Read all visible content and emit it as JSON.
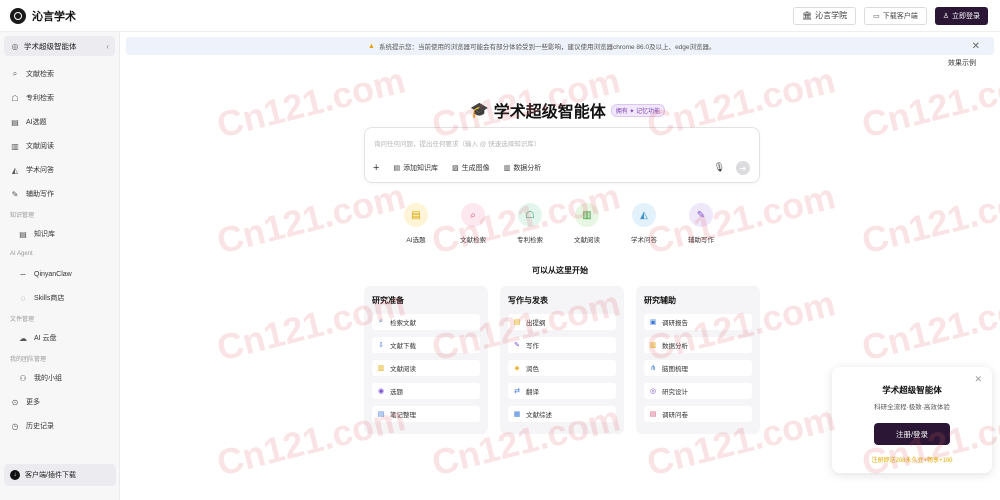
{
  "app": {
    "name": "沁言学术"
  },
  "topbar": {
    "academy_label": "沁言学院",
    "download_label": "下载客户端",
    "login_label": "立即登录"
  },
  "sidebar": {
    "head_label": "学术超级智能体",
    "items": [
      {
        "label": "文献检索",
        "icon": "document-search-icon"
      },
      {
        "label": "专利检索",
        "icon": "patent-icon"
      },
      {
        "label": "AI选题",
        "icon": "ai-topic-icon"
      },
      {
        "label": "文献阅读",
        "icon": "book-icon"
      },
      {
        "label": "学术问答",
        "icon": "graduation-cap-icon"
      },
      {
        "label": "辅助写作",
        "icon": "pen-icon"
      }
    ],
    "section_knowledge": "知识管理",
    "knowledge_item": "知识库",
    "section_agent": "AI Agent",
    "agent_items": [
      "QinyanClaw",
      "Skills商店"
    ],
    "section_files": "文件管理",
    "files_item": "AI 云盘",
    "section_team": "我的团队管理",
    "team_item": "我的小组",
    "more_label": "更多",
    "history_label": "历史记录",
    "bottom_label": "客户端/插件下载"
  },
  "notice": {
    "text": "系统提示您：当前使用的浏览器可能会有部分体验受到一些影响，建议使用浏览器chrome 86.0及以上、edge浏览器。",
    "example_label": "效果示例"
  },
  "hero": {
    "title": "学术超级智能体",
    "badge": "拥有 ✦ 记忆功能"
  },
  "input": {
    "placeholder": "询问任何问题，提出任何要求（输入 @ 快速选择知识库）",
    "add_kb": "添加知识库",
    "gen_image": "生成图像",
    "data_analysis": "数据分析"
  },
  "features": [
    {
      "label": "AI选题",
      "icon": "ai-topic-icon",
      "color": "#fff5d6",
      "fg": "#d9a400",
      "glyph": "▤"
    },
    {
      "label": "文献检索",
      "icon": "document-search-icon",
      "color": "#fde8ef",
      "fg": "#d8587c",
      "glyph": "⌕"
    },
    {
      "label": "专利检索",
      "icon": "patent-icon",
      "color": "#e2f6ee",
      "fg": "#2d9c70",
      "glyph": "☖"
    },
    {
      "label": "文献阅读",
      "icon": "book-icon",
      "color": "#e8f6e4",
      "fg": "#3d9a3a",
      "glyph": "▥"
    },
    {
      "label": "学术问答",
      "icon": "graduation-cap-icon",
      "color": "#e3f1fb",
      "fg": "#3b8fcf",
      "glyph": "◭"
    },
    {
      "label": "辅助写作",
      "icon": "pen-icon",
      "color": "#efe8fb",
      "fg": "#7b4fcf",
      "glyph": "✎"
    }
  ],
  "start_title": "可以从这里开始",
  "cards": [
    {
      "title": "研究准备",
      "items": [
        {
          "label": "检索文献",
          "icon": "search-icon",
          "glyph": "⌕",
          "fg": "#3b7bd8"
        },
        {
          "label": "文献下载",
          "icon": "download-icon",
          "glyph": "⇩",
          "fg": "#3b7bd8"
        },
        {
          "label": "文献阅读",
          "icon": "book-icon",
          "glyph": "▥",
          "fg": "#e0a800"
        },
        {
          "label": "选题",
          "icon": "bulb-icon",
          "glyph": "◉",
          "fg": "#7b4fcf"
        },
        {
          "label": "笔记整理",
          "icon": "note-icon",
          "glyph": "▤",
          "fg": "#3b7bd8"
        }
      ]
    },
    {
      "title": "写作与发表",
      "items": [
        {
          "label": "出提纲",
          "icon": "outline-icon",
          "glyph": "▤",
          "fg": "#e0a800"
        },
        {
          "label": "写作",
          "icon": "pen-icon",
          "glyph": "✎",
          "fg": "#7b4fcf"
        },
        {
          "label": "润色",
          "icon": "polish-icon",
          "glyph": "◈",
          "fg": "#e0a800"
        },
        {
          "label": "翻译",
          "icon": "translate-icon",
          "glyph": "⇄",
          "fg": "#3b7bd8"
        },
        {
          "label": "文献综述",
          "icon": "review-icon",
          "glyph": "▦",
          "fg": "#3b7bd8"
        }
      ]
    },
    {
      "title": "研究辅助",
      "items": [
        {
          "label": "调研报告",
          "icon": "report-icon",
          "glyph": "▣",
          "fg": "#3b7bd8"
        },
        {
          "label": "数据分析",
          "icon": "chart-icon",
          "glyph": "▥",
          "fg": "#e0a800"
        },
        {
          "label": "脑图梳理",
          "icon": "mindmap-icon",
          "glyph": "⋔",
          "fg": "#3b7bd8"
        },
        {
          "label": "研究设计",
          "icon": "design-icon",
          "glyph": "◎",
          "fg": "#7b4fcf"
        },
        {
          "label": "调研问卷",
          "icon": "survey-icon",
          "glyph": "▤",
          "fg": "#d8587c"
        }
      ]
    }
  ],
  "popup": {
    "title": "学术超级智能体",
    "subtitle": "科研全流程·极致·高效体验",
    "button": "注册/登录",
    "note": "注册即送208永久豆+畅享+100"
  },
  "watermark": "Cn121.com"
}
